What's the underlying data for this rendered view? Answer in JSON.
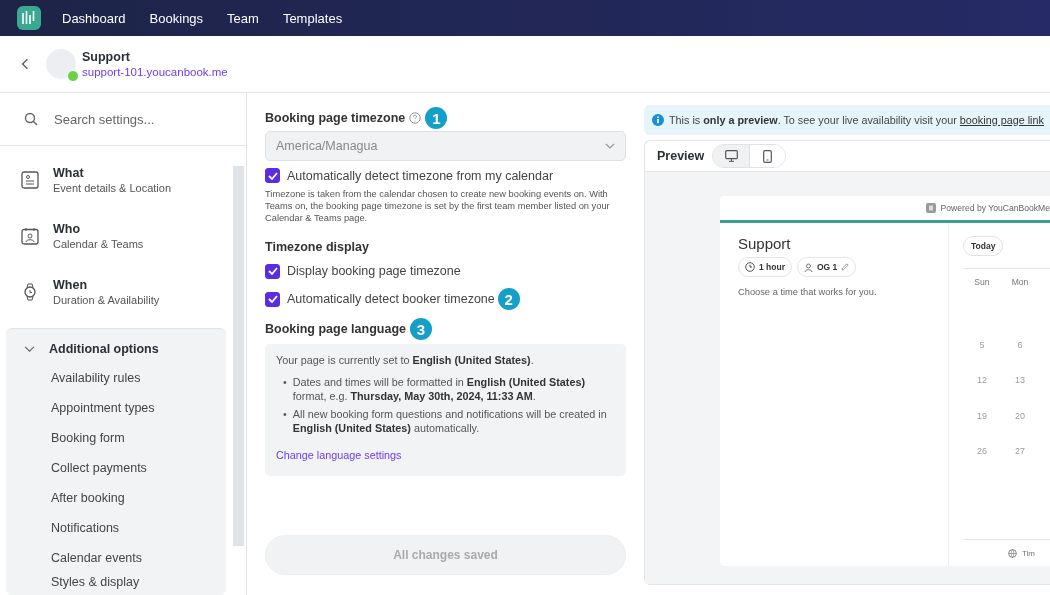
{
  "nav": {
    "items": [
      {
        "label": "Dashboard"
      },
      {
        "label": "Bookings"
      },
      {
        "label": "Team"
      },
      {
        "label": "Templates"
      }
    ]
  },
  "header": {
    "title": "Support",
    "url": "support-101.youcanbook.me",
    "online": true
  },
  "sidebar": {
    "search": {
      "placeholder": "Search settings..."
    },
    "sections": [
      {
        "title": "What",
        "subtitle": "Event details & Location"
      },
      {
        "title": "Who",
        "subtitle": "Calendar & Teams"
      },
      {
        "title": "When",
        "subtitle": "Duration & Availability"
      }
    ],
    "more": {
      "title": "Additional options",
      "expanded": true,
      "items": [
        "Availability rules",
        "Appointment types",
        "Booking form",
        "Collect payments",
        "After booking",
        "Notifications",
        "Calendar events",
        "Styles & display"
      ]
    }
  },
  "settings": {
    "timezone": {
      "label": "Booking page timezone",
      "marker": "1",
      "value": "America/Managua",
      "disabled": true,
      "auto": {
        "label": "Automatically detect timezone from my calendar",
        "checked": true
      },
      "help": "Timezone is taken from the calendar chosen to create new booking events on. With Teams on, the booking page timezone is set by the first team member listed on your Calendar & Teams page."
    },
    "display": {
      "title": "Timezone display",
      "options": [
        {
          "label": "Display booking page timezone",
          "checked": true
        },
        {
          "label": "Automatically detect booker timezone",
          "checked": true,
          "marker": "2"
        }
      ]
    },
    "language": {
      "label": "Booking page language",
      "marker": "3",
      "intro": "Your page is currently set to **English (United States)**.",
      "bullet_marker": "•",
      "bullets": [
        "Dates and times will be formatted in **English (United States)** format, e.g. **Thursday, May 30th, 2024, 11:33 AM**.",
        "All new booking form questions and notifications will be created in **English (United States)** automatically."
      ],
      "link": "Change language settings"
    },
    "save": {
      "label": "All changes saved",
      "disabled": true
    }
  },
  "preview": {
    "notice": "This is **only a preview**. To see your live availability visit your",
    "notice_link": "booking page link",
    "title": "Preview",
    "devices": [
      {
        "kind": "desktop",
        "selected": true
      },
      {
        "kind": "mobile",
        "selected": false
      }
    ],
    "page": {
      "powered": "Powered by YouCanBookMe",
      "title": "Support",
      "chips": [
        {
          "kind": "duration",
          "label": "1 hour"
        },
        {
          "kind": "host",
          "label": "OG 1"
        }
      ],
      "description": "Choose a time that works for you.",
      "today": "Today",
      "weekdays": [
        "Sun",
        "Mon"
      ],
      "weeks": [
        [
          "5",
          "6"
        ],
        [
          "12",
          "13"
        ],
        [
          "19",
          "20"
        ],
        [
          "26",
          "27"
        ]
      ],
      "footer": "Tim"
    }
  }
}
